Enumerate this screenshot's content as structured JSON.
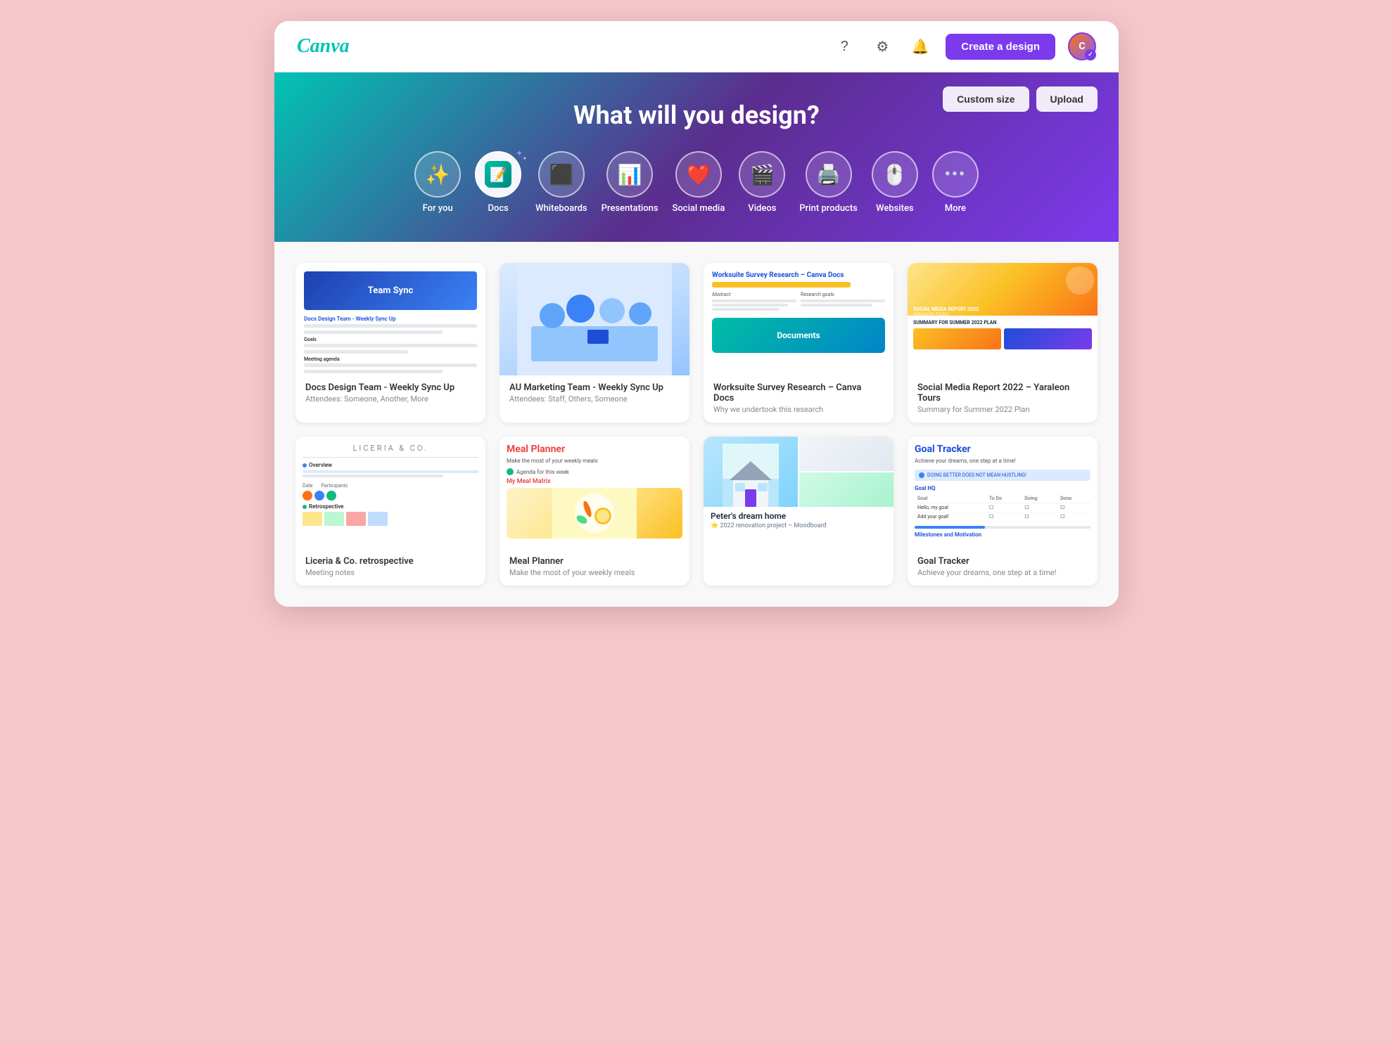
{
  "app": {
    "logo": "Canva",
    "create_btn": "Create a design"
  },
  "header": {
    "help_icon": "?",
    "settings_icon": "⚙",
    "notifications_icon": "🔔",
    "avatar_initials": "C"
  },
  "hero": {
    "title": "What will you design?",
    "custom_size_btn": "Custom size",
    "upload_btn": "Upload",
    "categories": [
      {
        "id": "for-you",
        "label": "For you",
        "icon": "✨",
        "active": false
      },
      {
        "id": "docs",
        "label": "Docs",
        "icon": "📄",
        "active": true
      },
      {
        "id": "whiteboards",
        "label": "Whiteboards",
        "icon": "🟩",
        "active": false
      },
      {
        "id": "presentations",
        "label": "Presentations",
        "icon": "📊",
        "active": false
      },
      {
        "id": "social-media",
        "label": "Social media",
        "icon": "❤️",
        "active": false
      },
      {
        "id": "videos",
        "label": "Videos",
        "icon": "🎬",
        "active": false
      },
      {
        "id": "print-products",
        "label": "Print products",
        "icon": "🖨️",
        "active": false
      },
      {
        "id": "websites",
        "label": "Websites",
        "icon": "🖱️",
        "active": false
      },
      {
        "id": "more",
        "label": "More",
        "icon": "•••",
        "active": false
      }
    ]
  },
  "recent": {
    "row1": [
      {
        "id": "team-sync",
        "title": "Docs Design Team - Weekly Sync Up",
        "subtitle": "Attendees: Someone, Another, More",
        "type": "doc"
      },
      {
        "id": "au-marketing",
        "title": "AU Marketing Team - Weekly Sync Up",
        "subtitle": "Attendees: Staff, Others, Someone",
        "type": "photo"
      },
      {
        "id": "canva-docs",
        "title": "Worksuite Survey Research – Canva Docs",
        "subtitle": "Why we undertook this research",
        "type": "doc-blue"
      },
      {
        "id": "social-report",
        "title": "Social Media Report 2022 – Yaraleon Tours",
        "subtitle": "Summary for Summer 2022 Plan",
        "type": "social"
      }
    ],
    "row2": [
      {
        "id": "liceria",
        "title": "Liceria & Co. retrospective",
        "subtitle": "Meeting notes",
        "type": "liceria"
      },
      {
        "id": "meal-planner",
        "title": "Meal Planner",
        "subtitle": "Make the most of your weekly meals",
        "type": "meal"
      },
      {
        "id": "dream-home",
        "title": "Peter's dream home",
        "subtitle": "2022 renovation project – Moodboard",
        "type": "home"
      },
      {
        "id": "goal-tracker",
        "title": "Goal Tracker",
        "subtitle": "Achieve your dreams, one step at a time!",
        "type": "goal"
      }
    ]
  }
}
